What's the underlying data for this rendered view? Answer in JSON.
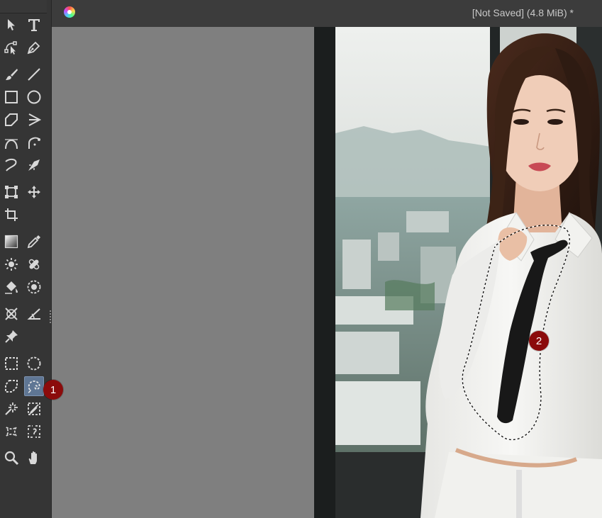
{
  "titlebar": {
    "app_icon": "color-wheel-icon",
    "status_text": "[Not Saved]   (4.8 MiB) *"
  },
  "toolbox": {
    "active_tool": "free-select-tool",
    "tools": [
      "pointer-tool",
      "text-tool",
      "path-tool",
      "pen-tool",
      "brush-tool",
      "line-tool",
      "rectangle-tool",
      "ellipse-tool",
      "polygon-tool",
      "polyline-tool",
      "bezier-tool",
      "freehand-bezier-tool",
      "calligraphy-tool",
      "dynamic-brush-tool",
      "transform-tool",
      "move-tool",
      "crop-tool",
      "gradient-tool",
      "color-picker-tool",
      "smart-patch-tool",
      "assistant-tool",
      "fill-tool",
      "enclose-fill-tool",
      "measure-angle-tool",
      "measure-tool",
      "reference-pin-tool",
      "rect-select-tool",
      "ellipse-select-tool",
      "polygon-select-tool",
      "free-select-tool",
      "magic-wand-tool",
      "similar-select-tool",
      "bezier-select-tool",
      "magnetic-select-tool",
      "zoom-tool",
      "pan-tool"
    ]
  },
  "markers": {
    "m1": "1",
    "m2": "2"
  },
  "colors": {
    "marker": "#8b0b0b",
    "active_tool_bg": "#5f7694"
  }
}
